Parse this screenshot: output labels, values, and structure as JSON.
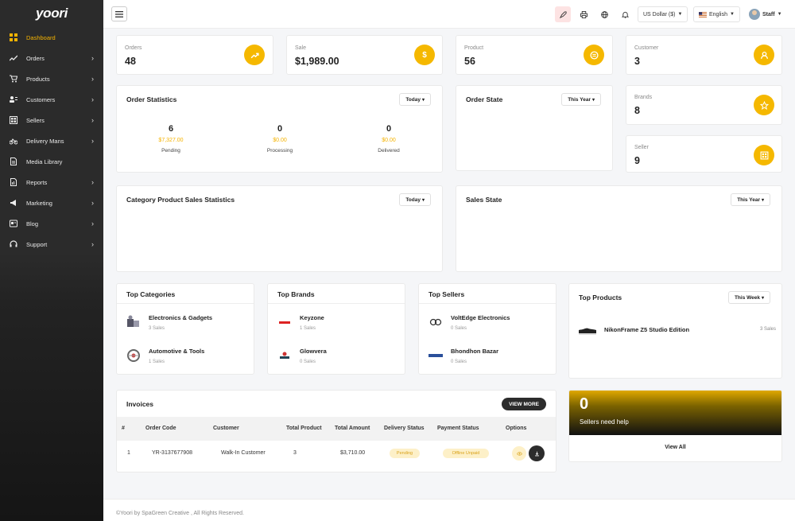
{
  "brand": {
    "logo": "yoori"
  },
  "sidebar": {
    "items": [
      {
        "label": "Dashboard",
        "icon": "dashboard-icon",
        "active": true,
        "has_children": false
      },
      {
        "label": "Orders",
        "icon": "trend-icon",
        "has_children": true
      },
      {
        "label": "Products",
        "icon": "cart-icon",
        "has_children": true
      },
      {
        "label": "Customers",
        "icon": "customers-icon",
        "has_children": true
      },
      {
        "label": "Sellers",
        "icon": "store-icon",
        "has_children": true
      },
      {
        "label": "Delivery Mans",
        "icon": "bicycle-icon",
        "has_children": true
      },
      {
        "label": "Media Library",
        "icon": "file-icon",
        "has_children": false
      },
      {
        "label": "Reports",
        "icon": "report-icon",
        "has_children": true
      },
      {
        "label": "Marketing",
        "icon": "megaphone-icon",
        "has_children": true
      },
      {
        "label": "Blog",
        "icon": "blog-icon",
        "has_children": true
      },
      {
        "label": "Support",
        "icon": "headset-icon",
        "has_children": true
      }
    ],
    "chevron": "›"
  },
  "topbar": {
    "currency": "US Dollar ($)",
    "language": "English",
    "user": "Staff"
  },
  "stats": {
    "orders": {
      "label": "Orders",
      "value": "48"
    },
    "sale": {
      "label": "Sale",
      "value": "$1,989.00"
    },
    "product": {
      "label": "Product",
      "value": "56"
    },
    "customer": {
      "label": "Customer",
      "value": "3"
    },
    "brands": {
      "label": "Brands",
      "value": "8"
    },
    "seller": {
      "label": "Seller",
      "value": "9"
    }
  },
  "order_statistics": {
    "title": "Order Statistics",
    "filter": "Today",
    "columns": [
      {
        "count": "6",
        "amount": "$7,327.00",
        "label": "Pending"
      },
      {
        "count": "0",
        "amount": "$0.00",
        "label": "Processing"
      },
      {
        "count": "0",
        "amount": "$0.00",
        "label": "Delivered"
      }
    ]
  },
  "order_state": {
    "title": "Order State",
    "filter": "This Year"
  },
  "category_sales": {
    "title": "Category Product Sales Statistics",
    "filter": "Today"
  },
  "sales_state": {
    "title": "Sales State",
    "filter": "This Year"
  },
  "top_categories": {
    "title": "Top Categories",
    "items": [
      {
        "name": "Electronics & Gadgets",
        "sub": "3 Sales"
      },
      {
        "name": "Automotive & Tools",
        "sub": "1 Sales"
      }
    ]
  },
  "top_brands": {
    "title": "Top Brands",
    "items": [
      {
        "name": "Keyzone",
        "sub": "1 Sales"
      },
      {
        "name": "Glowvera",
        "sub": "0 Sales"
      }
    ]
  },
  "top_sellers": {
    "title": "Top Sellers",
    "items": [
      {
        "name": "VoltEdge Electronics",
        "sub": "0 Sales"
      },
      {
        "name": "Bhondhon Bazar",
        "sub": "0 Sales"
      }
    ]
  },
  "top_products": {
    "title": "Top Products",
    "filter": "This Week",
    "items": [
      {
        "name": "NikonFrame Z5 Studio Edition",
        "sales": "3 Sales"
      }
    ]
  },
  "invoices": {
    "title": "Invoices",
    "view_more": "VIEW MORE",
    "columns": [
      "#",
      "Order Code",
      "Customer",
      "Total Product",
      "Total Amount",
      "Delivery Status",
      "Payment Status",
      "Options"
    ],
    "rows": [
      {
        "index": "1",
        "order_code": "YR-3137677908",
        "customer": "Walk-In Customer",
        "total_product": "3",
        "total_amount": "$3,710.00",
        "delivery_status": "Pending",
        "payment_status": "Offline Unpaid"
      }
    ]
  },
  "sellers_help": {
    "count": "0",
    "label": "Sellers need help",
    "link": "View All"
  },
  "footer": {
    "text": "©Yoori by SpaGreen Creative , All Rights Reserved."
  },
  "colors": {
    "accent": "#f5b800",
    "sidebar": "#2b2b2b",
    "pill_bg": "#fdf0c8"
  }
}
